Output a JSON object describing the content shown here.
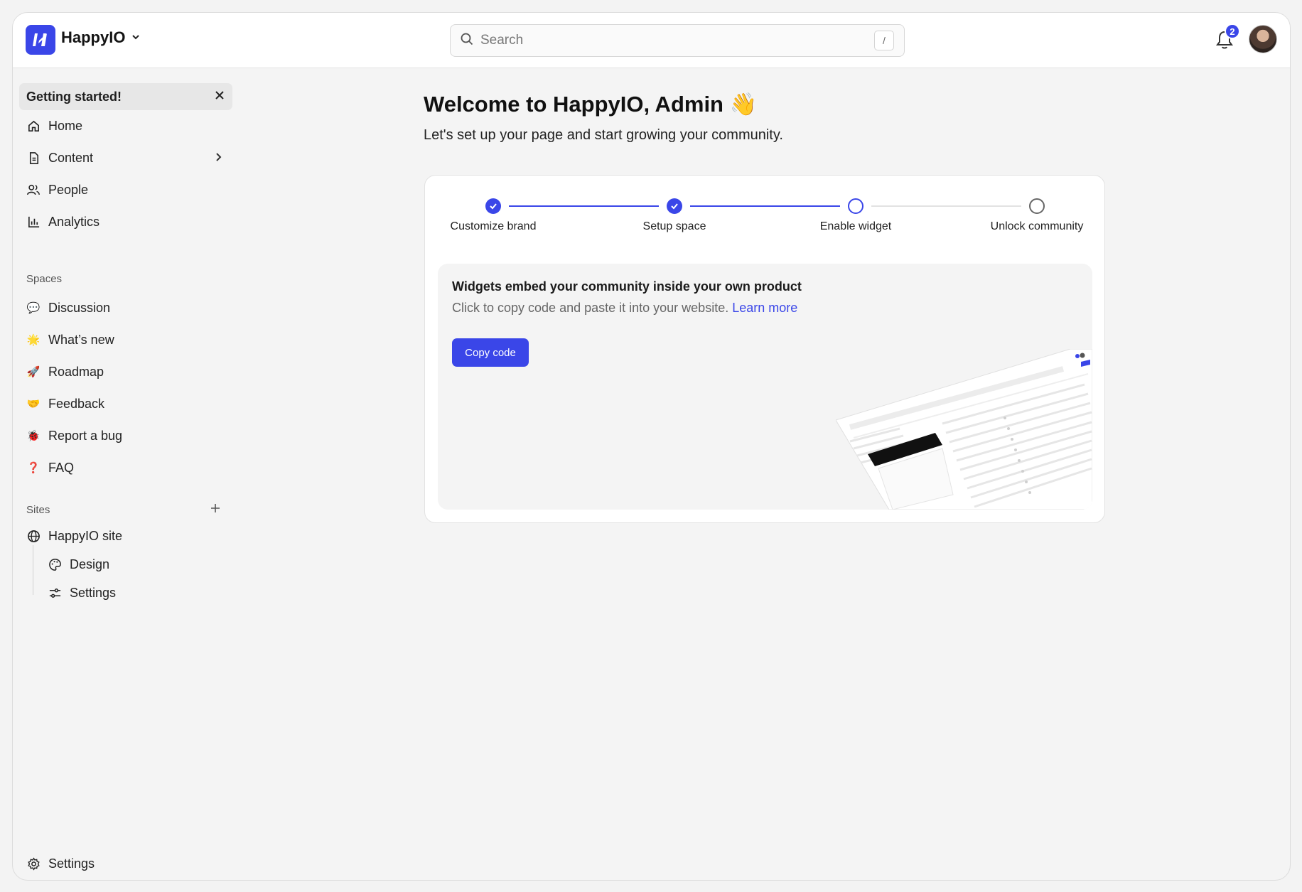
{
  "header": {
    "brand": "HappyIO",
    "search_placeholder": "Search",
    "search_shortcut": "/",
    "notification_count": "2"
  },
  "sidebar": {
    "banner": "Getting started!",
    "nav": [
      {
        "label": "Home",
        "icon": "home-icon"
      },
      {
        "label": "Content",
        "icon": "document-icon"
      },
      {
        "label": "People",
        "icon": "people-icon"
      },
      {
        "label": "Analytics",
        "icon": "bar-chart-icon"
      }
    ],
    "spaces_label": "Spaces",
    "spaces": [
      {
        "label": "Discussion",
        "emoji": "💬"
      },
      {
        "label": "What’s new",
        "emoji": "🌟"
      },
      {
        "label": "Roadmap",
        "emoji": "🚀"
      },
      {
        "label": "Feedback",
        "emoji": "🤝"
      },
      {
        "label": "Report a bug",
        "emoji": "🐞"
      },
      {
        "label": "FAQ",
        "emoji": "❓"
      }
    ],
    "sites_label": "Sites",
    "site": {
      "label": "HappyIO site",
      "children": [
        {
          "label": "Design"
        },
        {
          "label": "Settings"
        }
      ]
    },
    "settings": "Settings"
  },
  "main": {
    "title": "Welcome to HappyIO, Admin 👋",
    "subtitle": "Let's set up your page and start growing your community.",
    "steps": [
      {
        "label": "Customize brand",
        "state": "done"
      },
      {
        "label": "Setup space",
        "state": "done"
      },
      {
        "label": "Enable widget",
        "state": "active"
      },
      {
        "label": "Unlock community",
        "state": "todo"
      }
    ],
    "widget": {
      "heading": "Widgets embed your community inside your own product",
      "description": "Click to copy code and paste it into your website.",
      "link": "Learn more",
      "button": "Copy code"
    }
  },
  "colors": {
    "accent": "#3a46e8",
    "background": "#f4f4f4"
  }
}
